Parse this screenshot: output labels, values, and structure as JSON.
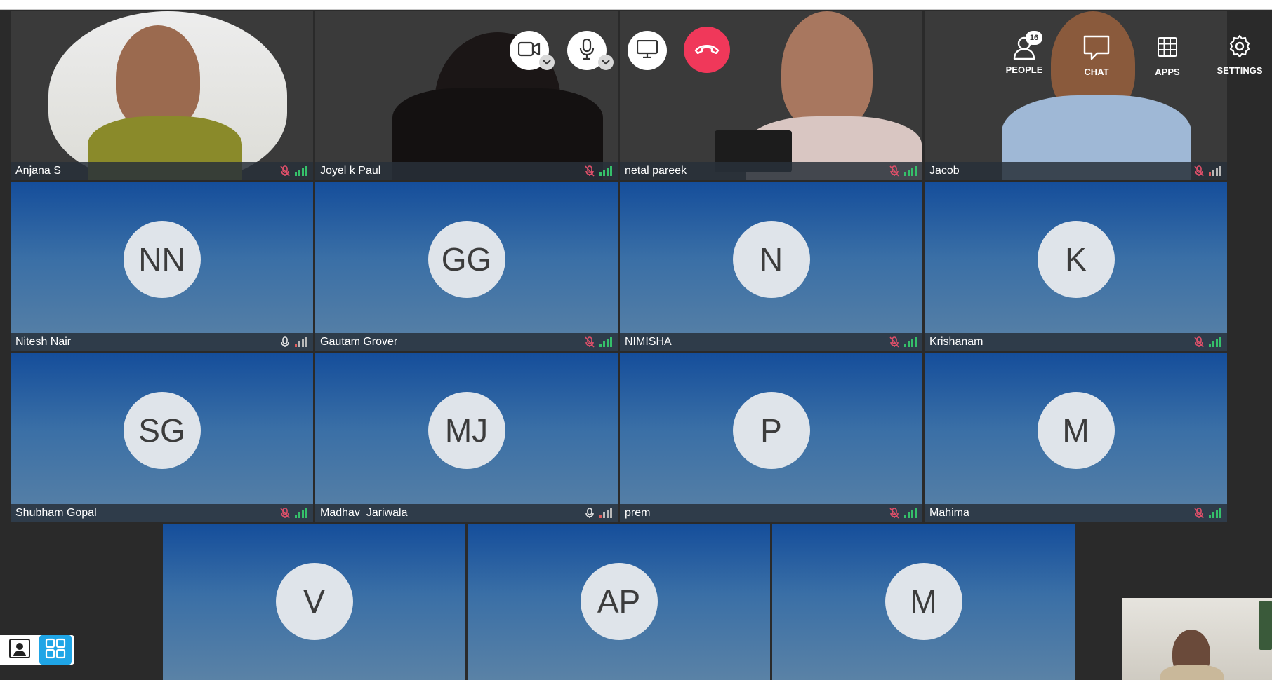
{
  "controls": {
    "camera_label": "camera",
    "mic_label": "microphone",
    "share_label": "share screen",
    "hangup_label": "leave"
  },
  "toolbar": {
    "people_label": "PEOPLE",
    "people_count": "16",
    "chat_label": "CHAT",
    "apps_label": "APPS",
    "settings_label": "SETTINGS"
  },
  "participants": [
    {
      "name": "Anjana S",
      "initials": "",
      "mic": "muted",
      "signal": "good"
    },
    {
      "name": "Joyel k Paul",
      "initials": "",
      "mic": "muted",
      "signal": "good"
    },
    {
      "name": "netal pareek",
      "initials": "",
      "mic": "muted",
      "signal": "good"
    },
    {
      "name": "Jacob",
      "initials": "",
      "mic": "muted",
      "signal": "weak"
    },
    {
      "name": "Nitesh Nair",
      "initials": "NN",
      "mic": "on",
      "signal": "weak"
    },
    {
      "name": "Gautam Grover",
      "initials": "GG",
      "mic": "muted",
      "signal": "good"
    },
    {
      "name": "NIMISHA",
      "initials": "N",
      "mic": "muted",
      "signal": "good"
    },
    {
      "name": "Krishanam",
      "initials": "K",
      "mic": "muted",
      "signal": "good"
    },
    {
      "name": "Shubham Gopal",
      "initials": "SG",
      "mic": "muted",
      "signal": "good"
    },
    {
      "name": "Madhav  Jariwala",
      "initials": "MJ",
      "mic": "on",
      "signal": "weak"
    },
    {
      "name": "prem",
      "initials": "P",
      "mic": "muted",
      "signal": "good"
    },
    {
      "name": "Mahima",
      "initials": "M",
      "mic": "muted",
      "signal": "good"
    },
    {
      "name": "",
      "initials": "V",
      "mic": "",
      "signal": ""
    },
    {
      "name": "",
      "initials": "AP",
      "mic": "",
      "signal": ""
    },
    {
      "name": "",
      "initials": "M",
      "mic": "",
      "signal": ""
    }
  ],
  "colors": {
    "accent": "#1fa5e6",
    "hangup": "#f0385a",
    "signal_good": "#35c06a",
    "muted_mic": "#e0506a"
  }
}
